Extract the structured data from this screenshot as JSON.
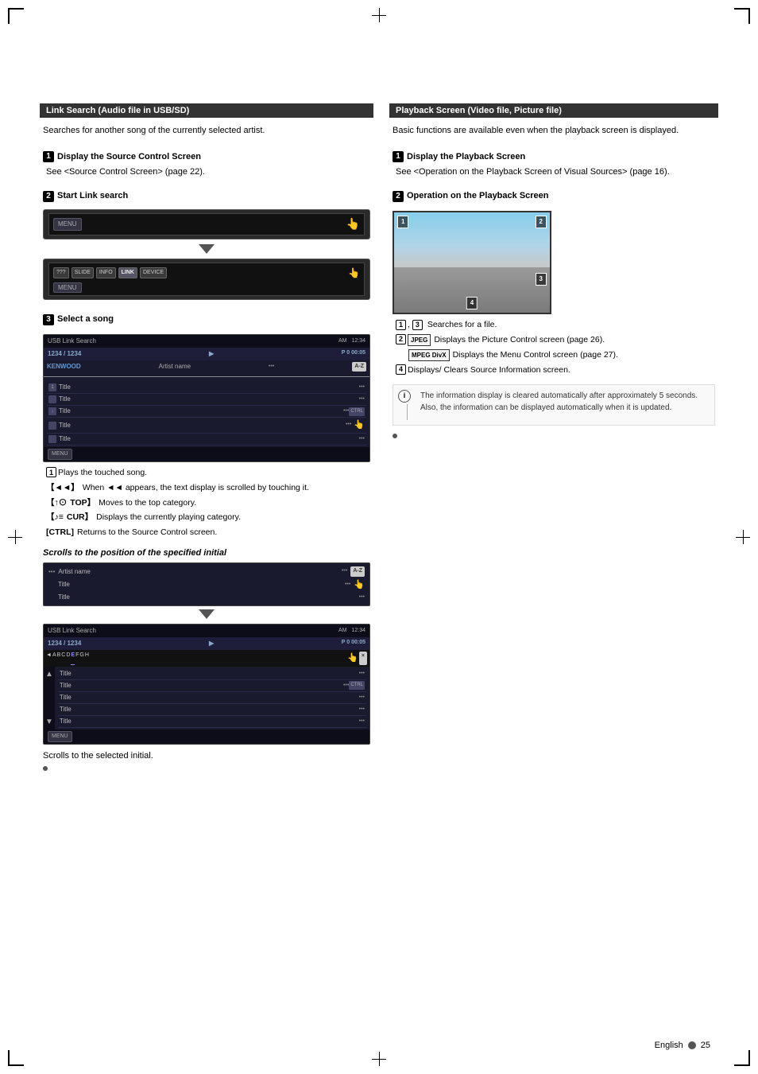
{
  "page": {
    "language": "English",
    "page_number": "25"
  },
  "left_section": {
    "header": "Link Search (Audio file in USB/SD)",
    "intro": "Searches for another song of the currently selected artist.",
    "step1": {
      "num": "1",
      "label": "Display the Source Control Screen",
      "sub": "See <Source Control Screen> (page 22)."
    },
    "step2": {
      "num": "2",
      "label": "Start Link search"
    },
    "step3": {
      "num": "3",
      "label": "Select a song"
    },
    "usb_screen": {
      "title": "USB Link Search",
      "track_info": "1234 / 1234",
      "progress": "P 0  00:05",
      "artist": "Artist name",
      "az_label": "A-Z",
      "items": [
        {
          "label": "Title",
          "dots": "•••"
        },
        {
          "label": "Title",
          "dots": "•••"
        },
        {
          "label": "Title",
          "dots": "•••",
          "ctrl": true
        },
        {
          "label": "Title",
          "dots": "•••"
        },
        {
          "label": "Title",
          "dots": "•••"
        }
      ]
    },
    "bullet_items": [
      {
        "icon": "1",
        "text": "Plays the touched song."
      },
      {
        "icon": "◄◄",
        "text": "When ◄◄ appears, the text display is scrolled by touching it."
      },
      {
        "icon": "↑⊙ TOP",
        "text": "Moves to the top category."
      },
      {
        "icon": "♪≡ CUR",
        "text": "Displays the currently playing category."
      },
      {
        "icon": "CTRL",
        "text": "Returns to the Source Control screen."
      }
    ],
    "scrolls_heading": "Scrolls to the position of the specified initial",
    "scrolls_caption": "Scrolls to the selected initial."
  },
  "right_section": {
    "header": "Playback Screen (Video file, Picture file)",
    "intro": "Basic functions are available even when the playback screen is displayed.",
    "step1": {
      "num": "1",
      "label": "Display the Playback Screen",
      "sub": "See <Operation on the Playback Screen of Visual Sources> (page 16)."
    },
    "step2": {
      "num": "2",
      "label": "Operation on the Playback Screen"
    },
    "playback_bullets": [
      {
        "icons": "1, 3",
        "text": "Searches for a file."
      },
      {
        "icon_type": "jpeg",
        "badge": "JPEG",
        "text": "Displays the Picture Control screen (page 26)."
      },
      {
        "icon_type": "mpeg",
        "badge": "MPEG DivX",
        "text": "Displays the Menu Control screen (page 27)."
      },
      {
        "icon": "4",
        "text": "Displays/ Clears Source Information screen."
      }
    ],
    "info_note": "The information display is cleared automatically after approximately 5 seconds. Also, the information can be displayed automatically when it is updated."
  },
  "menu_screens": {
    "menu1_label": "MENU",
    "menu2_label": "MENU",
    "buttons": [
      "???",
      "SLIDE",
      "INFO",
      "LINK",
      "DEVICE"
    ]
  }
}
